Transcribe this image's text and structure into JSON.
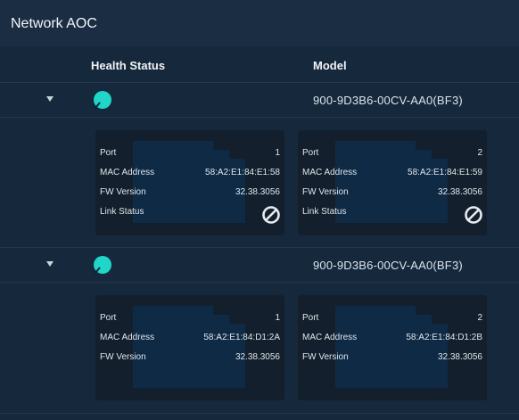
{
  "header": {
    "title": "Network AOC"
  },
  "columns": {
    "health": "Health Status",
    "model": "Model"
  },
  "rows": [
    {
      "model": "900-9D3B6-00CV-AA0(BF3)",
      "health": "ok-check-icon",
      "cards": [
        {
          "port_label": "Port",
          "port": "1",
          "mac_label": "MAC Address",
          "mac": "58:A2:E1:84:E1:58",
          "fw_label": "FW Version",
          "fw": "32.38.3056",
          "link_label": "Link Status",
          "link_icon": "no-link-icon"
        },
        {
          "port_label": "Port",
          "port": "2",
          "mac_label": "MAC Address",
          "mac": "58:A2:E1:84:E1:59",
          "fw_label": "FW Version",
          "fw": "32.38.3056",
          "link_label": "Link Status",
          "link_icon": "no-link-icon"
        }
      ]
    },
    {
      "model": "900-9D3B6-00CV-AA0(BF3)",
      "health": "ok-check-icon",
      "cards": [
        {
          "port_label": "Port",
          "port": "1",
          "mac_label": "MAC Address",
          "mac": "58:A2:E1:84:D1:2A",
          "fw_label": "FW Version",
          "fw": "32.38.3056"
        },
        {
          "port_label": "Port",
          "port": "2",
          "mac_label": "MAC Address",
          "mac": "58:A2:E1:84:D1:2B",
          "fw_label": "FW Version",
          "fw": "32.38.3056"
        }
      ]
    }
  ],
  "colors": {
    "background": "#16283c",
    "card": "#131f2c",
    "port_shape": "#0f2a45",
    "health_ok": "#1fd6c8"
  }
}
